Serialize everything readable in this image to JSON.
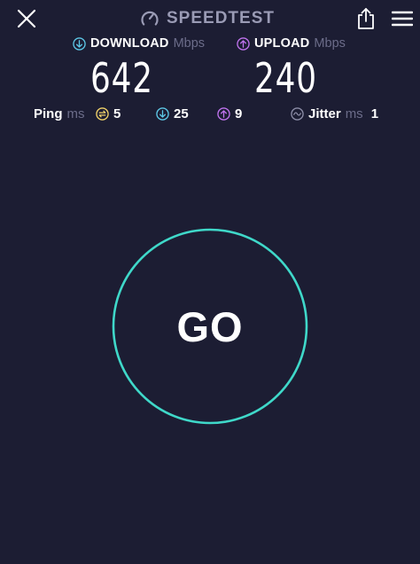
{
  "header": {
    "title": "SPEEDTEST"
  },
  "metrics": {
    "download": {
      "label": "DOWNLOAD",
      "unit": "Mbps",
      "value": "642"
    },
    "upload": {
      "label": "UPLOAD",
      "unit": "Mbps",
      "value": "240"
    }
  },
  "stats": {
    "ping": {
      "label": "Ping",
      "unit": "ms"
    },
    "idle_latency": {
      "value": "5"
    },
    "download_latency": {
      "value": "25"
    },
    "upload_latency": {
      "value": "9"
    },
    "jitter": {
      "label": "Jitter",
      "unit": "ms",
      "value": "1"
    }
  },
  "go_button": {
    "label": "GO"
  },
  "colors": {
    "background": "#1c1d33",
    "ring": "#3fd8c9",
    "download_accent": "#5ec9e8",
    "upload_accent": "#c174ef",
    "idle_accent": "#f3d36a",
    "muted": "#6b6c89",
    "brand": "#9a9bb5"
  },
  "icons": {
    "close": "close-icon",
    "gauge": "speedometer-icon",
    "share": "share-icon",
    "menu": "hamburger-menu-icon",
    "download": "arrow-down-circle-icon",
    "upload": "arrow-up-circle-icon",
    "idle": "idle-latency-icon",
    "jitter": "jitter-wave-icon"
  }
}
